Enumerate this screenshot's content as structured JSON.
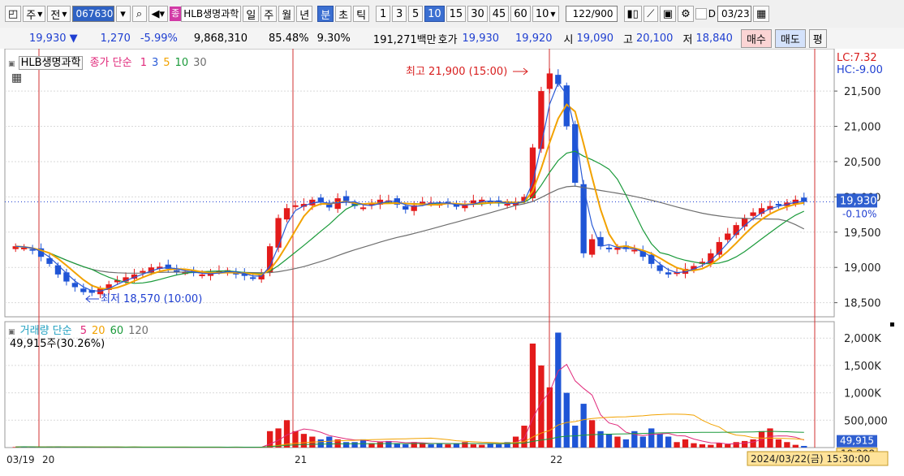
{
  "toolbar": {
    "type_label": "주",
    "mode_label": "전",
    "stock_code": "067630",
    "stock_badge": "종",
    "stock_name": "HLB생명과학",
    "periods": [
      "일",
      "주",
      "월",
      "년",
      "분",
      "초",
      "틱"
    ],
    "active_period": "분",
    "intervals": [
      "1",
      "3",
      "5",
      "10",
      "15",
      "30",
      "45",
      "60"
    ],
    "active_interval": "10",
    "interval_select": "10",
    "count_display": "122/900",
    "date_flag": "D",
    "date_value": "03/23"
  },
  "quote": {
    "price": "19,930",
    "direction_arrow": "▼",
    "change": "1,270",
    "change_pct": "-5.99%",
    "volume": "9,868,310",
    "vol_ratio": "85.48%",
    "turnover": "9.30%",
    "amount": "191,271백만",
    "bidask_label": "호가",
    "ask": "19,930",
    "bid": "19,920",
    "open_label": "시",
    "open": "19,090",
    "high_label": "고",
    "high": "20,100",
    "low_label": "저",
    "low": "18,840",
    "buy_label": "매수",
    "sell_label": "매도",
    "eval_label": "평"
  },
  "price_panel": {
    "name": "HLB생명과학",
    "indicator_label": "종가 단순",
    "ma_periods": [
      "1",
      "3",
      "5",
      "10",
      "30"
    ],
    "lc_text": "LC:7.32",
    "hc_text": "HC:-9.00",
    "y_ticks": [
      "21,500",
      "21,000",
      "20,500",
      "20,000",
      "19,500",
      "19,000",
      "18,500"
    ],
    "current_price_tag": "19,930",
    "current_pct_tag": "-0.10%",
    "high_annot": "최고 21,900 (15:00)",
    "low_annot": "최저 18,570 (10:00)"
  },
  "volume_panel": {
    "indicator_label": "거래량 단순",
    "ma_periods": [
      "5",
      "20",
      "60",
      "120"
    ],
    "current_volume": "49,915주(30.26%)",
    "y_ticks": [
      "2,000K",
      "1,500K",
      "1,000K",
      "500,000"
    ],
    "current_tag": "49,915",
    "avg_tag": "19,298"
  },
  "x_axis": {
    "labels": [
      "03/19",
      "20",
      "21",
      "22"
    ],
    "cursor_label": "2024/03/22(금) 15:30:00"
  },
  "colors": {
    "up": "#e31b1b",
    "down": "#1f55d6",
    "ma1": "#e0287a",
    "ma3": "#2a5bd7",
    "ma5": "#f2a200",
    "ma10": "#1a9a3a",
    "ma30": "#6e6e6e",
    "day_separator": "#d23030",
    "grid": "#d9d9d9"
  },
  "chart_data": {
    "type": "candlestick",
    "days": [
      "03/19",
      "20",
      "21",
      "22"
    ],
    "price_ylim": [
      18300,
      22100
    ],
    "price_close": [
      19300,
      19280,
      19240,
      19150,
      19050,
      18900,
      18800,
      18720,
      18650,
      18640,
      18700,
      18760,
      18820,
      18860,
      18900,
      18950,
      19000,
      19010,
      18980,
      18950,
      18930,
      18920,
      18900,
      18910,
      18950,
      18960,
      18900,
      18880,
      18850,
      18900,
      19300,
      19700,
      19840,
      19880,
      19900,
      19960,
      19920,
      19850,
      19980,
      19940,
      19870,
      19850,
      19910,
      19960,
      19950,
      19890,
      19820,
      19880,
      19930,
      19920,
      19900,
      19910,
      19860,
      19880,
      19950,
      19960,
      19920,
      19910,
      19900,
      19910,
      20000,
      20700,
      21500,
      21750,
      21600,
      21000,
      20200,
      19200,
      19400,
      19300,
      19270,
      19280,
      19260,
      19250,
      19150,
      19050,
      18950,
      18900,
      18930,
      18980,
      19020,
      19080,
      19200,
      19360,
      19480,
      19600,
      19700,
      19780,
      19840,
      19870,
      19890,
      19920,
      19960,
      19930
    ],
    "volume_k": [
      10,
      20,
      8,
      5,
      20,
      15,
      5,
      10,
      5,
      8,
      5,
      10,
      5,
      8,
      12,
      5,
      5,
      8,
      5,
      5,
      10,
      5,
      5,
      8,
      5,
      5,
      10,
      5,
      5,
      5,
      300,
      350,
      500,
      300,
      250,
      200,
      150,
      200,
      150,
      100,
      100,
      150,
      80,
      100,
      120,
      80,
      60,
      100,
      80,
      60,
      80,
      60,
      80,
      100,
      60,
      50,
      80,
      60,
      100,
      200,
      400,
      1900,
      1500,
      1100,
      2100,
      1000,
      400,
      800,
      500,
      300,
      250,
      200,
      150,
      300,
      200,
      350,
      250,
      200,
      100,
      150,
      80,
      60,
      50,
      80,
      60,
      100,
      120,
      150,
      300,
      350,
      150,
      100,
      50,
      30
    ]
  }
}
